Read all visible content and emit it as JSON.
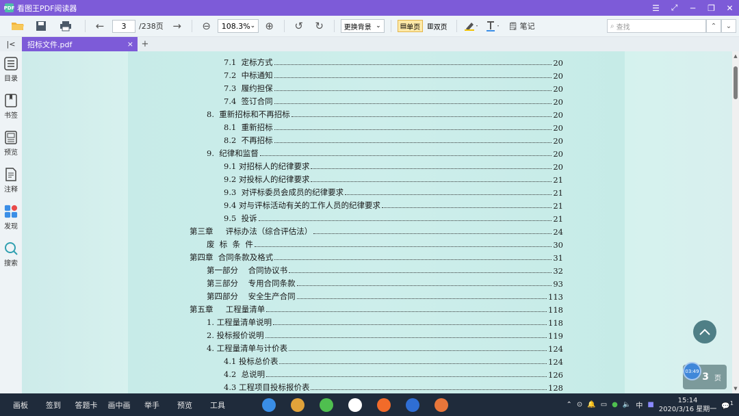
{
  "window": {
    "title": "看图王PDF阅读器",
    "logo_text": "PDF",
    "controls": [
      "☰",
      "⤢",
      "─",
      "❐",
      "✕"
    ]
  },
  "toolbar": {
    "current_page": "3",
    "total_pages": "/238页",
    "zoom": "108.3%",
    "background_label": "更换背景",
    "single_page_label": "单页",
    "double_page_label": "双页",
    "note_label": "笔记",
    "search_placeholder": "查找"
  },
  "tabs": [
    {
      "label": "招标文件.pdf",
      "close": "×"
    }
  ],
  "new_tab": "+",
  "collapse": "|<",
  "sidebar": [
    {
      "label": "目录",
      "icon": "toc-icon"
    },
    {
      "label": "书签",
      "icon": "bookmark-icon"
    },
    {
      "label": "预览",
      "icon": "preview-icon"
    },
    {
      "label": "注释",
      "icon": "annotation-icon"
    },
    {
      "label": "发现",
      "icon": "discover-icon"
    },
    {
      "label": "搜索",
      "icon": "search-icon"
    }
  ],
  "toc": [
    {
      "text": "7.1  定标方式",
      "page": "20",
      "indent": 2
    },
    {
      "text": "7.2  中标通知",
      "page": "20",
      "indent": 2
    },
    {
      "text": "7.3  履约担保",
      "page": "20",
      "indent": 2
    },
    {
      "text": "7.4  签订合同",
      "page": "20",
      "indent": 2
    },
    {
      "text": "8.  重新招标和不再招标",
      "page": "20",
      "indent": 1
    },
    {
      "text": "8.1  重新招标",
      "page": "20",
      "indent": 2
    },
    {
      "text": "8.2  不再招标",
      "page": "20",
      "indent": 2
    },
    {
      "text": "9.  纪律和监督",
      "page": "20",
      "indent": 1
    },
    {
      "text": "9.1 对招标人的纪律要求",
      "page": "20",
      "indent": 2
    },
    {
      "text": "9.2 对投标人的纪律要求",
      "page": "21",
      "indent": 2
    },
    {
      "text": "9.3  对评标委员会成员的纪律要求",
      "page": "21",
      "indent": 2
    },
    {
      "text": "9.4 对与评标活动有关的工作人员的纪律要求",
      "page": "21",
      "indent": 2
    },
    {
      "text": "9.5  投诉",
      "page": "21",
      "indent": 2
    },
    {
      "text": "第三章     评标办法（综合评估法）",
      "page": "24",
      "indent": 0
    },
    {
      "text": "废  标  条  件",
      "page": "30",
      "indent": 1
    },
    {
      "text": "第四章  合同条款及格式",
      "page": "31",
      "indent": 0
    },
    {
      "text": "第一部分    合同协议书",
      "page": "32",
      "indent": 1
    },
    {
      "text": "第三部分    专用合同条款",
      "page": "93",
      "indent": 1
    },
    {
      "text": "第四部分    安全生产合同",
      "page": "113",
      "indent": 1
    },
    {
      "text": "第五章     工程量清单",
      "page": "118",
      "indent": 0
    },
    {
      "text": "1. 工程量清单说明",
      "page": "118",
      "indent": 1
    },
    {
      "text": "2. 投标报价说明",
      "page": "119",
      "indent": 1
    },
    {
      "text": "4. 工程量清单与计价表",
      "page": "124",
      "indent": 1
    },
    {
      "text": "4.1 投标总价表",
      "page": "124",
      "indent": 2
    },
    {
      "text": "4.2  总说明",
      "page": "126",
      "indent": 2
    },
    {
      "text": "4.3 工程项目投标报价表",
      "page": "128",
      "indent": 2
    }
  ],
  "page_indicator": {
    "number": "3",
    "unit": "页",
    "timer": "03:49"
  },
  "taskbar": {
    "tools": [
      "画板",
      "签到",
      "答题卡",
      "画中画",
      "举手",
      "预览",
      "工具"
    ],
    "apps": [
      {
        "icon": "power-icon",
        "color": "#3a8ee6"
      },
      {
        "icon": "chrome-icon",
        "color": "#e0a23a"
      },
      {
        "icon": "play-icon",
        "color": "#4fbf4f"
      },
      {
        "icon": "flower-icon",
        "color": "#ffffff"
      },
      {
        "icon": "office-icon",
        "color": "#f26b2a"
      },
      {
        "icon": "layers-icon",
        "color": "#2f6ed4"
      },
      {
        "icon": "pdf-icon",
        "color": "#e8763a"
      }
    ],
    "ime": "中",
    "time": "15:14",
    "date": "2020/3/16 星期一",
    "notification": "1"
  }
}
